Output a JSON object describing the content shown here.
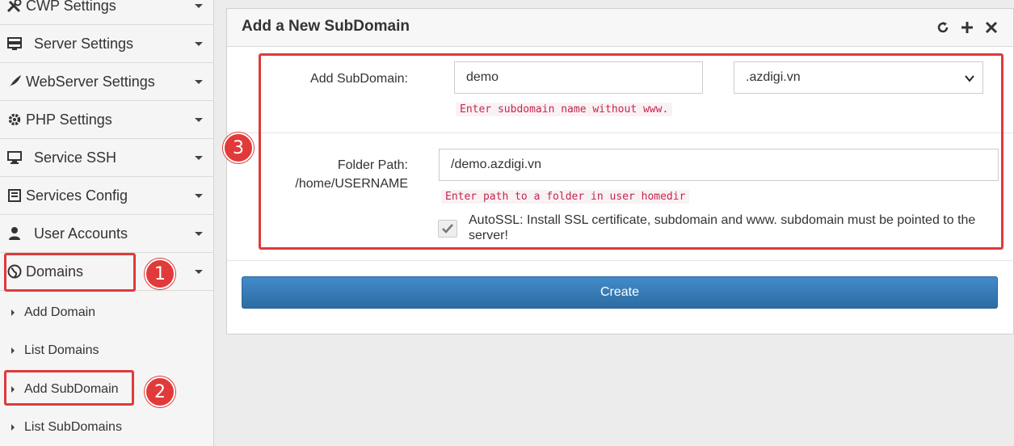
{
  "sidebar": {
    "menu": [
      {
        "label": "CWP Settings",
        "icon": "tools-icon"
      },
      {
        "label": "Server Settings",
        "icon": "server-icon"
      },
      {
        "label": "WebServer Settings",
        "icon": "feather-icon"
      },
      {
        "label": "PHP Settings",
        "icon": "gear-icon"
      },
      {
        "label": "Service SSH",
        "icon": "monitor-icon"
      },
      {
        "label": "Services Config",
        "icon": "config-icon"
      },
      {
        "label": "User Accounts",
        "icon": "user-icon"
      },
      {
        "label": "Domains",
        "icon": "globe-icon"
      }
    ],
    "submenu": [
      {
        "label": "Add Domain"
      },
      {
        "label": "List Domains"
      },
      {
        "label": "Add SubDomain"
      },
      {
        "label": "List SubDomains"
      }
    ]
  },
  "panel": {
    "title": "Add a New SubDomain",
    "tools": [
      "refresh-icon",
      "plus-icon",
      "close-icon"
    ],
    "subdomain_label": "Add SubDomain:",
    "subdomain_value": "demo",
    "domain_select": ".azdigi.vn",
    "subdomain_hint": "Enter subdomain name without www.",
    "folder_label_line1": "Folder Path:",
    "folder_label_line2": "/home/USERNAME",
    "folder_value": "/demo.azdigi.vn",
    "folder_hint": "Enter path to a folder in user homedir",
    "autossl_checked": true,
    "autossl_line1": "AutoSSL: Install SSL certificate, subdomain and www. subdomain must be pointed to the",
    "autossl_line2": "server!",
    "create_label": "Create"
  },
  "annotations": {
    "step1": "1",
    "step2": "2",
    "step3": "3",
    "color": "#e03a3a"
  }
}
